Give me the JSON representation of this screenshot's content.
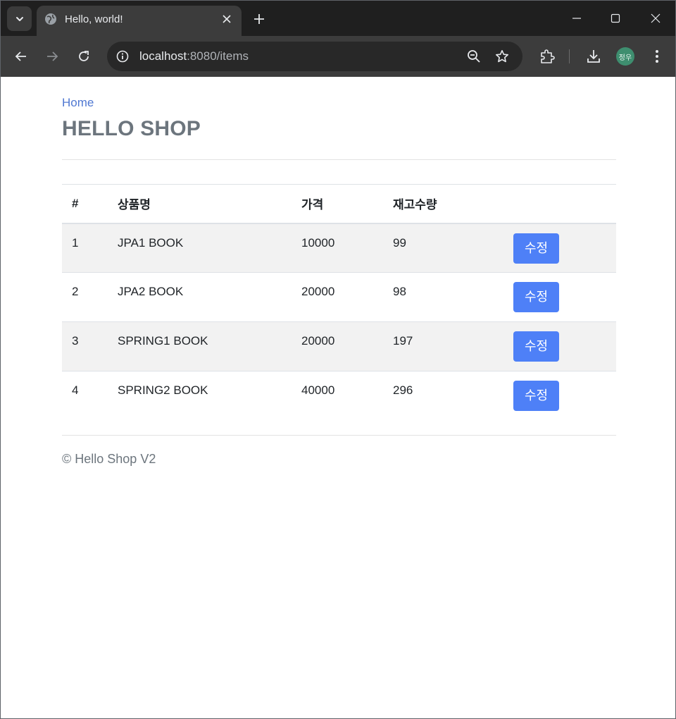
{
  "browser": {
    "tab_title": "Hello, world!",
    "url_host": "localhost",
    "url_path": ":8080/items",
    "profile_initials": "정우"
  },
  "header": {
    "home_link": "Home",
    "brand": "HELLO SHOP"
  },
  "table": {
    "columns": [
      "#",
      "상품명",
      "가격",
      "재고수량",
      ""
    ],
    "rows": [
      {
        "id": "1",
        "name": "JPA1 BOOK",
        "price": "10000",
        "stock": "99",
        "action": "수정"
      },
      {
        "id": "2",
        "name": "JPA2 BOOK",
        "price": "20000",
        "stock": "98",
        "action": "수정"
      },
      {
        "id": "3",
        "name": "SPRING1 BOOK",
        "price": "20000",
        "stock": "197",
        "action": "수정"
      },
      {
        "id": "4",
        "name": "SPRING2 BOOK",
        "price": "40000",
        "stock": "296",
        "action": "수정"
      }
    ]
  },
  "footer": {
    "text": "© Hello Shop V2"
  },
  "colors": {
    "link": "#5078d2",
    "button": "#4e80f7",
    "brand_text": "#6c757d"
  }
}
